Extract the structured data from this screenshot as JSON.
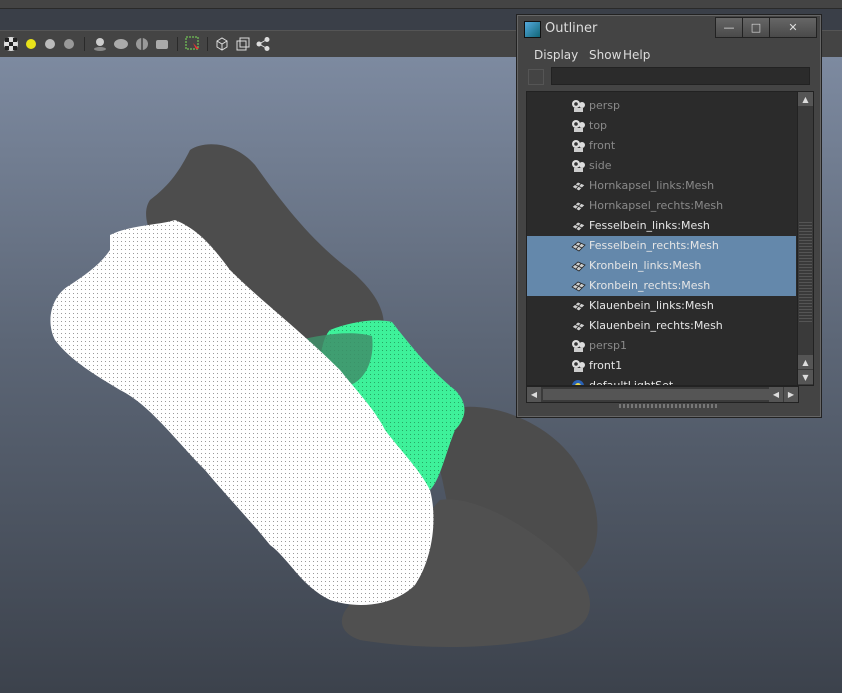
{
  "toolbar": {
    "icons": [
      "checker-shading-icon",
      "default-light-icon",
      "ambient-light-icon",
      "all-lights-icon",
      "shadows-icon",
      "screen-ao-icon",
      "motion-blur-icon",
      "multisample-icon",
      "isolate-select-icon",
      "xray-icon",
      "xray-joints-icon",
      "xray-active-icon"
    ]
  },
  "outliner": {
    "title": "Outliner",
    "window_buttons": {
      "minimize": "—",
      "maximize": "□",
      "close": "✕"
    },
    "menu": [
      "Display",
      "Show",
      "Help"
    ],
    "filter_value": "",
    "items": [
      {
        "label": "persp",
        "icon": "camera-icon",
        "dim": true,
        "selected": false
      },
      {
        "label": "top",
        "icon": "camera-icon",
        "dim": true,
        "selected": false
      },
      {
        "label": "front",
        "icon": "camera-icon",
        "dim": true,
        "selected": false
      },
      {
        "label": "side",
        "icon": "camera-icon",
        "dim": true,
        "selected": false
      },
      {
        "label": "Hornkapsel_links:Mesh",
        "icon": "mesh-icon",
        "dim": true,
        "selected": false
      },
      {
        "label": "Hornkapsel_rechts:Mesh",
        "icon": "mesh-icon",
        "dim": true,
        "selected": false
      },
      {
        "label": "Fesselbein_links:Mesh",
        "icon": "mesh-icon",
        "dim": false,
        "selected": false
      },
      {
        "label": "Fesselbein_rechts:Mesh",
        "icon": "mesh-icon",
        "dim": false,
        "selected": true
      },
      {
        "label": "Kronbein_links:Mesh",
        "icon": "mesh-icon",
        "dim": false,
        "selected": true
      },
      {
        "label": "Kronbein_rechts:Mesh",
        "icon": "mesh-icon",
        "dim": false,
        "selected": true
      },
      {
        "label": "Klauenbein_links:Mesh",
        "icon": "mesh-icon",
        "dim": false,
        "selected": false
      },
      {
        "label": "Klauenbein_rechts:Mesh",
        "icon": "mesh-icon",
        "dim": false,
        "selected": false
      },
      {
        "label": "persp1",
        "icon": "camera-icon",
        "dim": true,
        "selected": false
      },
      {
        "label": "front1",
        "icon": "camera-icon",
        "dim": false,
        "selected": false
      },
      {
        "label": "defaultLightSet",
        "icon": "light-set-icon",
        "dim": false,
        "selected": false
      }
    ]
  },
  "colors": {
    "selection": "#6488ab",
    "highlight_mesh": "#3ef19a",
    "bone_mesh": "#4c4c4c"
  }
}
